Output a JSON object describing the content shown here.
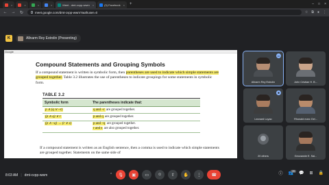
{
  "browser": {
    "tabs": [
      {
        "title": "",
        "favicon_color": "#ea4335"
      },
      {
        "title": "",
        "favicon_color": "#ea4335"
      },
      {
        "title": "",
        "favicon_color": "#34a853"
      },
      {
        "title": "",
        "favicon_color": "#4285f4"
      },
      {
        "title": "Meet - dmt-cvpp-wwm",
        "favicon_color": "#00897b"
      },
      {
        "title": "(3) Facebook",
        "favicon_color": "#1877f2"
      }
    ],
    "url": "meet.google.com/dmt-cvpp-wwm?authuser=0"
  },
  "meet": {
    "presenter": "Allnarm Rey Estrolin (Presenting)",
    "meeting_time": "8:03 AM",
    "meeting_code": "dmt-cvpp-wwm",
    "participant_count": "28"
  },
  "slide": {
    "top_strip": "Google",
    "title": "Compound Statements and Grouping Symbols",
    "para1_before": "If a compound statement is written in symbolic form, then ",
    "para1_highlight": "parentheses are used to indicate which simple statements are grouped together.",
    "para1_after": " Table 3.2 illustrates the use of parentheses to indicate groupings for some statements in symbolic form.",
    "table_label": "TABLE 3.2",
    "table": {
      "headers": [
        "Symbolic form",
        "The parentheses indicate that:"
      ],
      "rows": [
        {
          "form": "p ∧ (q ∨ ~r)",
          "meaning_hl": "q and ~r",
          "meaning": " are grouped together."
        },
        {
          "form": "(p ∧ q) ∨ r",
          "meaning_hl": "p and q",
          "meaning": " are grouped together."
        },
        {
          "form": "(p ∧ ~q) → (r ∨ s)",
          "meaning_hl": "p and ~q",
          "meaning": " are grouped together.",
          "meaning_hl2": "r and s",
          "meaning2": " are also grouped together."
        }
      ]
    },
    "para2": "If a compound statement is written as an English sentence, then a comma is used to indicate which simple statements are grouped together. Statements on the same side of"
  },
  "participants": [
    {
      "name": "Allnarm Rey Estrolin",
      "badge": "•••"
    },
    {
      "name": "John Cristian H. B...",
      "badge": ""
    },
    {
      "name": "Leonard Luyao",
      "badge": "✱"
    },
    {
      "name": "Rhonald marc Gel...",
      "badge": ""
    },
    {
      "name": "20 others",
      "badge": ""
    },
    {
      "name": "Geovannie E. Sal...",
      "badge": ""
    }
  ],
  "colors": {
    "hangup": "#ea4335",
    "highlight": "#f6ea6a",
    "table_header": "#d5e6cf"
  }
}
